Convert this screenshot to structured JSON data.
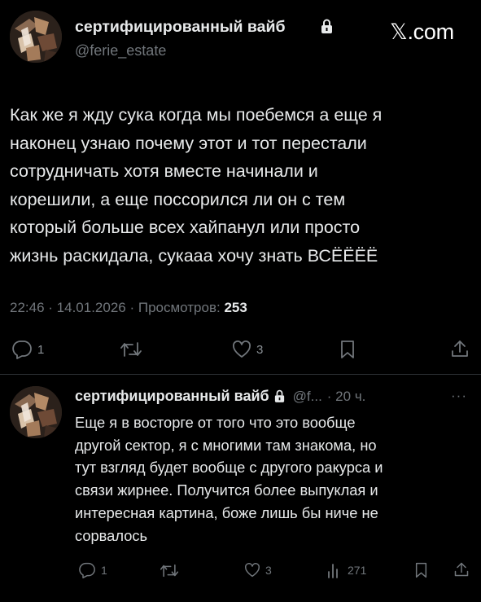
{
  "tweet": {
    "display_name": "сертифицированный вайб",
    "handle": "@ferie_estate",
    "brand": "𝕏.com",
    "text": "Как же я жду сука когда мы поебемся а еще я\nнаконец узнаю почему этот и тот перестали\nсотрудничать хотя вместе начинали и\nкорешили, а еще поссорился ли он с тем\nкоторый больше всех хайпанул или просто\nжизнь раскидала, сукааа хочу знать ВСЁЁЁЁ",
    "time": "22:46",
    "date": "14.01.2026",
    "views_label": "Просмотров:",
    "views_count": "253",
    "meta_separator": " · ",
    "actions": {
      "reply_count": "1",
      "retweet_count": "",
      "like_count": "3"
    }
  },
  "reply": {
    "display_name": "сертифицированный вайб",
    "handle": "@f...",
    "time_ago": "· 20 ч.",
    "more": "···",
    "text": "Еще я в восторге от того что это вообще\nдругой сектор, я с многими там знакома, но\nтут взгляд будет вообще с другого ракурса и\nсвязи жирнее. Получится более выпуклая и\nинтересная картина, боже лишь бы ниче не\nсорвалось",
    "actions": {
      "reply_count": "1",
      "like_count": "3",
      "views_count": "271"
    }
  },
  "icons": {
    "lock": "lock-icon",
    "reply": "reply-icon",
    "retweet": "retweet-icon",
    "like": "heart-icon",
    "bookmark": "bookmark-icon",
    "share": "share-icon",
    "views": "views-icon",
    "more": "more-icon"
  },
  "colors": {
    "background": "#000000",
    "text": "#e7e9ea",
    "secondary": "#71767b",
    "divider": "#2f3336"
  }
}
